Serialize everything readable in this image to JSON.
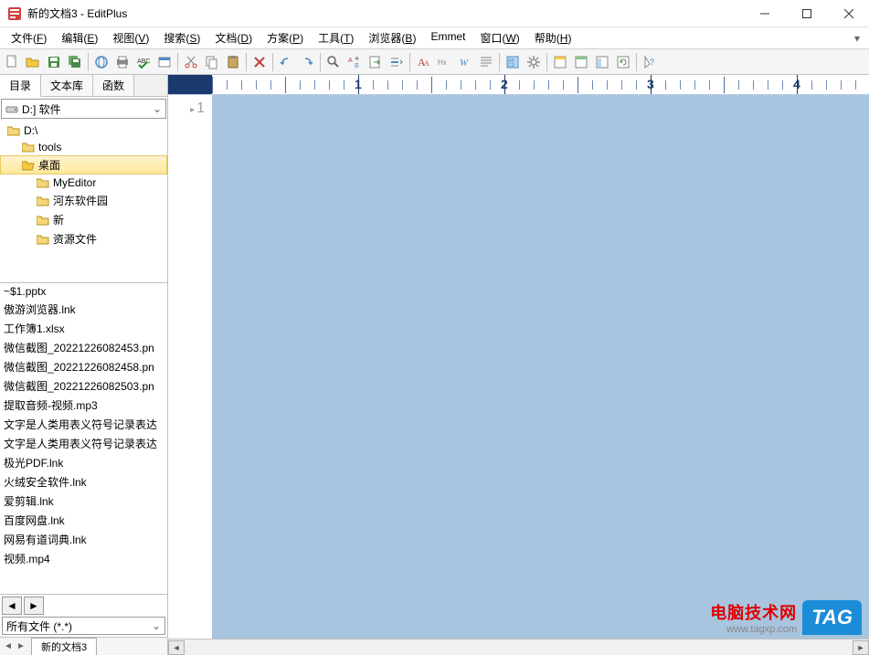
{
  "window": {
    "title": "新的文档3 - EditPlus"
  },
  "menu": {
    "items": [
      {
        "label": "文件",
        "key": "F"
      },
      {
        "label": "编辑",
        "key": "E"
      },
      {
        "label": "视图",
        "key": "V"
      },
      {
        "label": "搜索",
        "key": "S"
      },
      {
        "label": "文档",
        "key": "D"
      },
      {
        "label": "方案",
        "key": "P"
      },
      {
        "label": "工具",
        "key": "T"
      },
      {
        "label": "浏览器",
        "key": "B"
      },
      {
        "label": "Emmet",
        "key": ""
      },
      {
        "label": "窗口",
        "key": "W"
      },
      {
        "label": "帮助",
        "key": "H"
      }
    ]
  },
  "side_tabs": {
    "dir": "目录",
    "lib": "文本库",
    "func": "函数"
  },
  "drive": {
    "label": "D:] 软件"
  },
  "tree": [
    {
      "label": "D:\\",
      "indent": 0,
      "selected": false
    },
    {
      "label": "tools",
      "indent": 1,
      "selected": false
    },
    {
      "label": "桌面",
      "indent": 1,
      "selected": true
    },
    {
      "label": "MyEditor",
      "indent": 2,
      "selected": false
    },
    {
      "label": "河东软件园",
      "indent": 2,
      "selected": false
    },
    {
      "label": "新",
      "indent": 2,
      "selected": false
    },
    {
      "label": "资源文件",
      "indent": 2,
      "selected": false
    }
  ],
  "files": [
    "~$1.pptx",
    "傲游浏览器.lnk",
    "工作簿1.xlsx",
    "微信截图_20221226082453.pn",
    "微信截图_20221226082458.pn",
    "微信截图_20221226082503.pn",
    "提取音频-视频.mp3",
    "文字是人类用表义符号记录表达",
    "文字是人类用表义符号记录表达",
    "极光PDF.lnk",
    "火绒安全软件.lnk",
    "爱剪辑.lnk",
    "百度网盘.lnk",
    "网易有道词典.lnk",
    "视频.mp4"
  ],
  "filter": {
    "value": "所有文件 (*.*)"
  },
  "doc_tab": {
    "label": "新的文档3"
  },
  "ruler": {
    "marks": [
      "1",
      "2",
      "3",
      "4"
    ]
  },
  "editor": {
    "line_num": "1"
  },
  "watermark": {
    "line1": "电脑技术网",
    "line2": "www.tagxp.com",
    "tag": "TAG"
  }
}
